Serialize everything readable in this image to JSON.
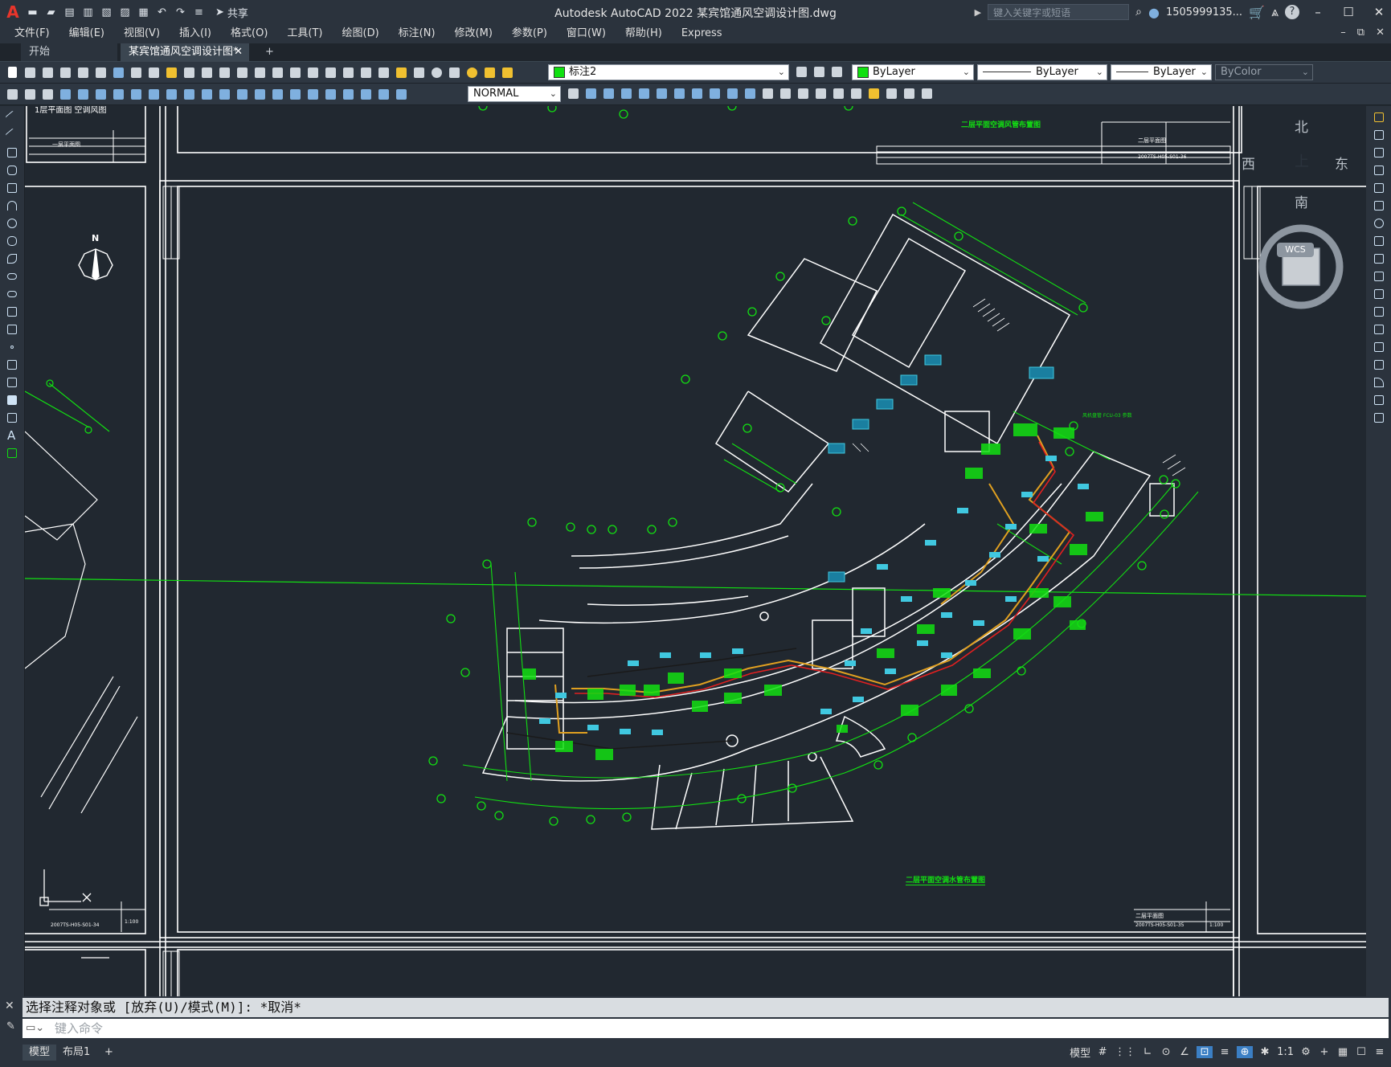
{
  "app": {
    "logo": "A",
    "title": "Autodesk AutoCAD 2022    某宾馆通风空调设计图.dwg",
    "share_label": "共享"
  },
  "title_right": {
    "search_placeholder": "键入关键字或短语",
    "user": "1505999135...",
    "min": "–",
    "max": "☐",
    "close": "✕"
  },
  "menu": {
    "items": [
      "文件(F)",
      "编辑(E)",
      "视图(V)",
      "插入(I)",
      "格式(O)",
      "工具(T)",
      "绘图(D)",
      "标注(N)",
      "修改(M)",
      "参数(P)",
      "窗口(W)",
      "帮助(H)",
      "Express"
    ],
    "right": [
      "–",
      "⧉",
      "✕"
    ]
  },
  "tabs": {
    "start": "开始",
    "doc": "某宾馆通风空调设计图*",
    "close": "✕",
    "add": "+"
  },
  "toolbar": {
    "layer": "标注2",
    "color": "ByLayer",
    "linetype": "ByLayer",
    "lineweight": "ByLayer",
    "plotstyle": "ByColor",
    "dimstyle": "NORMAL",
    "layer_color": "#10e010"
  },
  "viewcube": {
    "north": "北",
    "south": "南",
    "east": "东",
    "west": "西",
    "top": "上",
    "wcs": "WCS"
  },
  "drawing": {
    "label_tl": "二层平面空调风管布置图",
    "label_bottom": "二层平面空调水管布置图",
    "tb_name_1": "二层平面图",
    "tb_name_2": "二层平面图",
    "tb_code_1": "2007TS-H05-S01-35",
    "tb_code_2": "2007TS-H05-S01-36",
    "tb_scale": "1:100",
    "tb_left_code": "2007TS-H05-S01-34",
    "tb_left_scale": "1:100",
    "tb_left_name": "一层平面图",
    "top_left_text": "1层平面图 空调风图",
    "note_1": "风机盘管 FCU-03 参数",
    "compass_n": "N"
  },
  "command": {
    "history": "选择注释对象或 [放弃(U)/模式(M)]: *取消*",
    "placeholder": "键入命令",
    "close_icon": "✕",
    "wrench_icon": "🔧"
  },
  "status": {
    "model_tab": "模型",
    "layout_tab": "布局1",
    "add": "+",
    "model_btn": "模型",
    "scale": "1:1",
    "items": [
      "#",
      "⋮⋮",
      "∟",
      "⊙",
      "∠",
      "⊡",
      "≡",
      "⊕",
      "✱",
      "⚙",
      "+",
      "▦",
      "☐",
      "≡"
    ]
  },
  "colors": {
    "background": "#212830",
    "green": "#12e012",
    "white": "#ffffff",
    "orange": "#e0a020",
    "red": "#e02020",
    "cyan": "#40c8e0"
  }
}
